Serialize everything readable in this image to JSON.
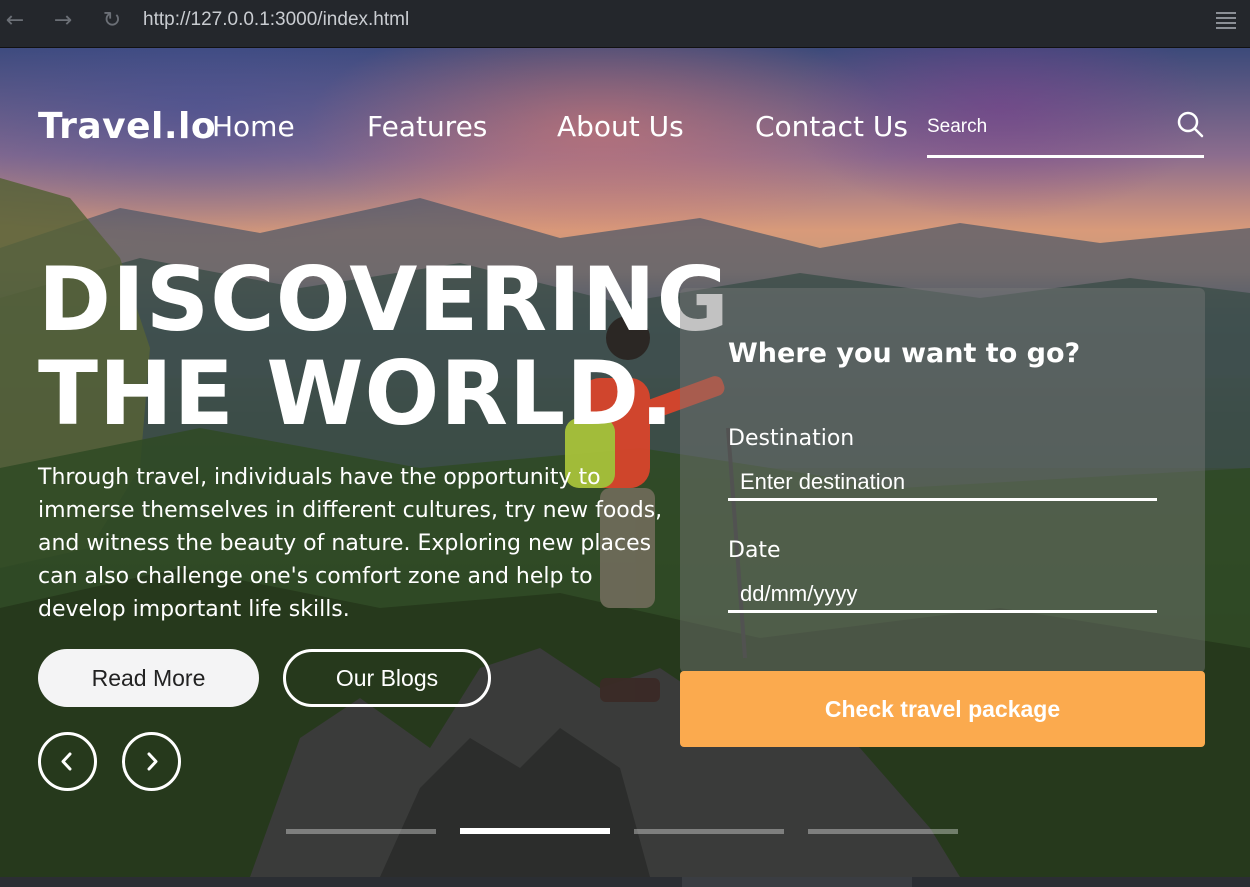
{
  "browser": {
    "url": "http://127.0.0.1:3000/index.html",
    "back_icon": "←",
    "forward_icon": "→",
    "reload_icon": "↻"
  },
  "nav": {
    "logo": "Travel.lo",
    "links": [
      "Home",
      "Features",
      "About Us",
      "Contact Us"
    ],
    "search_placeholder": "Search"
  },
  "hero": {
    "headline_line1": "DISCOVERING",
    "headline_line2": "THE WORLD.",
    "description": "Through travel, individuals have the opportunity to immerse themselves in different cultures, try new foods, and witness the beauty of nature. Exploring new places can also challenge one's comfort zone and help to develop important life skills.",
    "read_more_label": "Read More",
    "blogs_label": "Our Blogs",
    "slide_count": 4,
    "active_slide": 2
  },
  "booking": {
    "title": "Where you want to go?",
    "destination_label": "Destination",
    "destination_placeholder": "Enter destination",
    "date_label": "Date",
    "date_placeholder": "dd/mm/yyyy",
    "submit_label": "Check travel package"
  },
  "colors": {
    "accent": "#fbaa4e",
    "text": "#ffffff",
    "chrome": "#24272c"
  }
}
